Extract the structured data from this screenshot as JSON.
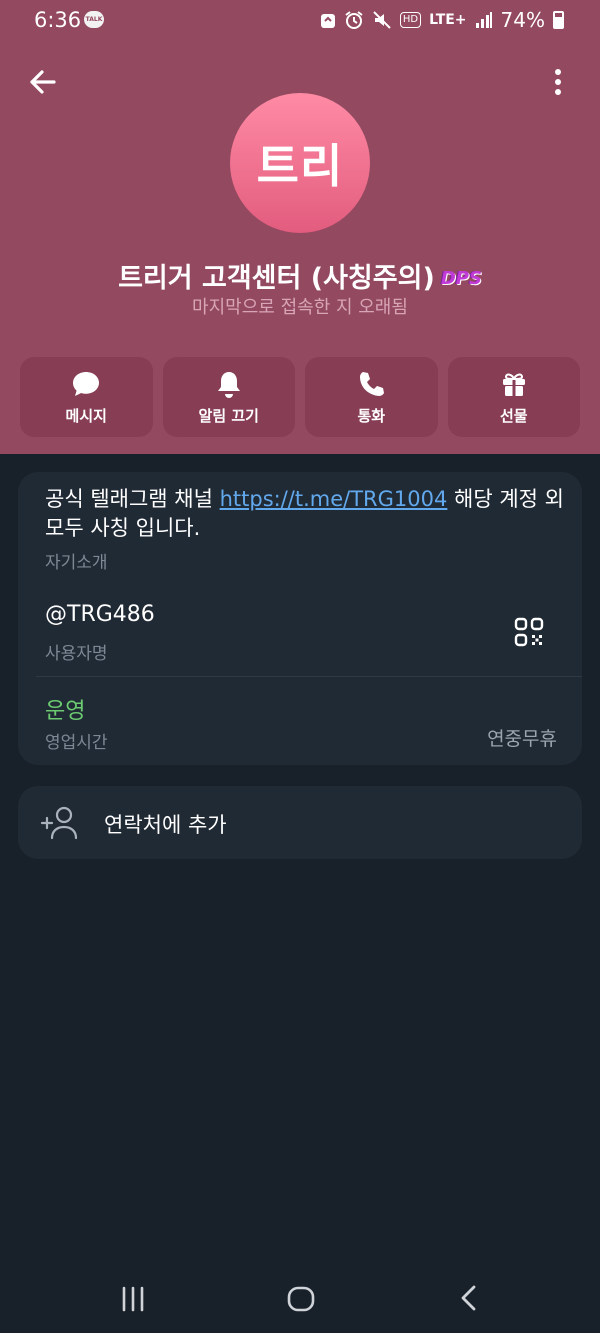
{
  "status_bar": {
    "time": "6:36",
    "talk_badge": "TALK",
    "network": "LTE+",
    "hd": "HD",
    "battery": "74%"
  },
  "profile": {
    "avatar_text": "트리",
    "name": "트리거 고객센터 (사칭주의)",
    "badge": "DPS",
    "last_seen": "마지막으로 접속한 지 오래됨",
    "avatar_gradient": [
      "#ff8ba5",
      "#e25c7e"
    ]
  },
  "actions": [
    {
      "label": "메시지",
      "icon": "message-icon"
    },
    {
      "label": "알림 끄기",
      "icon": "bell-icon"
    },
    {
      "label": "통화",
      "icon": "phone-icon"
    },
    {
      "label": "선물",
      "icon": "gift-icon"
    }
  ],
  "info": {
    "bio_prefix": "공식 텔래그램 채널 ",
    "bio_link": "https://t.me/TRG1004",
    "bio_suffix": " 해당 계정 외 모두 사칭 입니다.",
    "bio_label": "자기소개",
    "username": "@TRG486",
    "username_label": "사용자명",
    "hours_status": "운영",
    "hours_label": "영업시간",
    "hours_value": "연중무휴"
  },
  "add_contact": {
    "label": "연락처에 추가",
    "icon": "add-person-icon"
  },
  "colors": {
    "header": "#93495f",
    "action_button": "#873e55",
    "background": "#18202a",
    "card": "#202a35",
    "link": "#62a8ec",
    "online_green": "#6ccb71"
  }
}
